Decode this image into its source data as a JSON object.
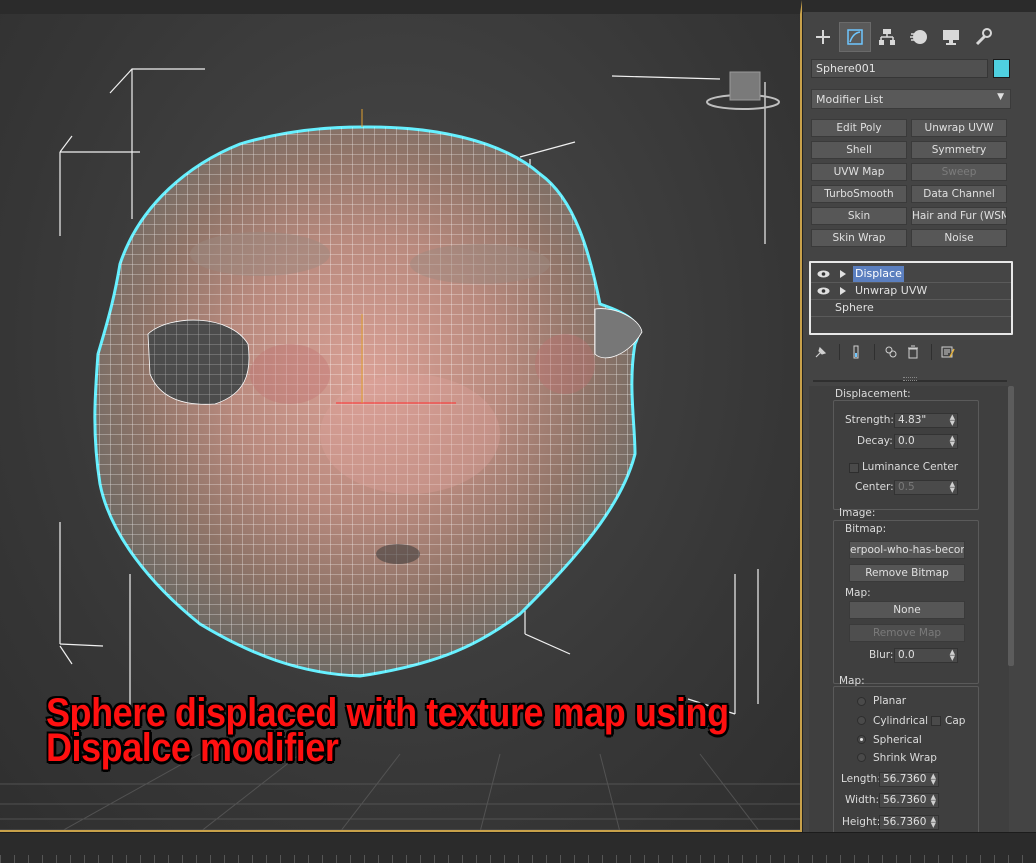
{
  "caption": {
    "line1": "Sphere displaced with texture map using",
    "line2": "Dispalce modifier"
  },
  "panel": {
    "tabs": [
      "create-icon",
      "modify-icon",
      "hierarchy-icon",
      "motion-icon",
      "display-icon",
      "utilities-icon"
    ],
    "object_name": "Sphere001",
    "object_color": "#4fd0e0",
    "modifier_list": "Modifier List",
    "modifier_buttons": [
      {
        "label": "Edit Poly",
        "enabled": true
      },
      {
        "label": "Unwrap UVW",
        "enabled": true
      },
      {
        "label": "Shell",
        "enabled": true
      },
      {
        "label": "Symmetry",
        "enabled": true
      },
      {
        "label": "UVW Map",
        "enabled": true
      },
      {
        "label": "Sweep",
        "enabled": false
      },
      {
        "label": "TurboSmooth",
        "enabled": true
      },
      {
        "label": "Data Channel",
        "enabled": true
      },
      {
        "label": "Skin",
        "enabled": true
      },
      {
        "label": "Hair and Fur (WSM)",
        "enabled": true
      },
      {
        "label": "Skin Wrap",
        "enabled": true
      },
      {
        "label": "Noise",
        "enabled": true
      }
    ],
    "stack": [
      {
        "label": "Displace",
        "selected": true
      },
      {
        "label": "Unwrap UVW",
        "selected": false
      },
      {
        "label": "Sphere",
        "selected": false
      }
    ]
  },
  "displacement": {
    "title": "Displacement:",
    "strength_label": "Strength:",
    "strength_value": "4.83\"",
    "decay_label": "Decay:",
    "decay_value": "0.0",
    "luminance_label": "Luminance Center",
    "center_label": "Center:",
    "center_value": "0.5"
  },
  "image": {
    "title": "Image:",
    "bitmap_label": "Bitmap:",
    "bitmap_value": "erpool-who-has-become-",
    "remove_bitmap": "Remove Bitmap",
    "map_label": "Map:",
    "map_value": "None",
    "remove_map": "Remove Map",
    "blur_label": "Blur:",
    "blur_value": "0.0"
  },
  "map": {
    "title": "Map:",
    "options": [
      {
        "label": "Planar",
        "checked": false
      },
      {
        "label": "Cylindrical",
        "checked": false
      },
      {
        "label": "Spherical",
        "checked": true
      },
      {
        "label": "Shrink Wrap",
        "checked": false
      }
    ],
    "cap_label": "Cap",
    "length_label": "Length:",
    "length_value": "56.7360",
    "width_label": "Width:",
    "width_value": "56.7360",
    "height_label": "Height:",
    "height_value": "56.7360"
  }
}
